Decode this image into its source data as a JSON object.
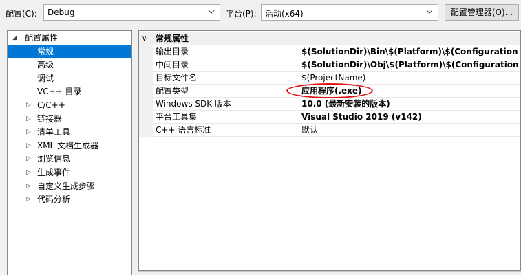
{
  "toolbar": {
    "config_label": "配置(C):",
    "config_value": "Debug",
    "platform_label": "平台(P):",
    "platform_value": "活动(x64)",
    "manager_button": "配置管理器(O)..."
  },
  "tree": {
    "items": [
      {
        "label": "配置属性",
        "expander": "◢",
        "indent": 0,
        "selected": false
      },
      {
        "label": "常规",
        "expander": "",
        "indent": 2,
        "selected": true
      },
      {
        "label": "高级",
        "expander": "",
        "indent": 2,
        "selected": false
      },
      {
        "label": "调试",
        "expander": "",
        "indent": 2,
        "selected": false
      },
      {
        "label": "VC++ 目录",
        "expander": "",
        "indent": 2,
        "selected": false
      },
      {
        "label": "C/C++",
        "expander": "▷",
        "indent": 1,
        "selected": false
      },
      {
        "label": "链接器",
        "expander": "▷",
        "indent": 1,
        "selected": false
      },
      {
        "label": "清单工具",
        "expander": "▷",
        "indent": 1,
        "selected": false
      },
      {
        "label": "XML 文档生成器",
        "expander": "▷",
        "indent": 1,
        "selected": false
      },
      {
        "label": "浏览信息",
        "expander": "▷",
        "indent": 1,
        "selected": false
      },
      {
        "label": "生成事件",
        "expander": "▷",
        "indent": 1,
        "selected": false
      },
      {
        "label": "自定义生成步骤",
        "expander": "▷",
        "indent": 1,
        "selected": false
      },
      {
        "label": "代码分析",
        "expander": "▷",
        "indent": 1,
        "selected": false
      }
    ]
  },
  "grid": {
    "category": "常规属性",
    "rows": [
      {
        "name": "输出目录",
        "value": "$(SolutionDir)\\Bin\\$(Platform)\\$(Configuration)\\",
        "bold": true
      },
      {
        "name": "中间目录",
        "value": "$(SolutionDir)\\Obj\\$(Platform)\\$(Configuration)\\",
        "bold": true
      },
      {
        "name": "目标文件名",
        "value": "$(ProjectName)",
        "bold": false
      },
      {
        "name": "配置类型",
        "value": "应用程序(.exe)",
        "bold": true
      },
      {
        "name": "Windows SDK 版本",
        "value": "10.0 (最新安装的版本)",
        "bold": true
      },
      {
        "name": "平台工具集",
        "value": "Visual Studio 2019 (v142)",
        "bold": true
      },
      {
        "name": "C++ 语言标准",
        "value": "默认",
        "bold": false
      }
    ]
  },
  "colors": {
    "selection": "#0078d7",
    "annotation": "#e01010"
  }
}
